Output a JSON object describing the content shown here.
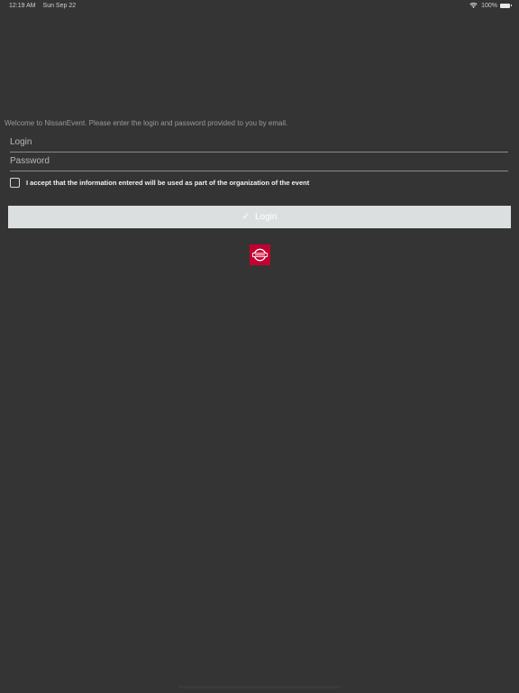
{
  "status_bar": {
    "time": "12:19 AM",
    "date": "Sun Sep 22",
    "battery": "100%"
  },
  "welcome": {
    "message": "Welcome to NissanEvent. Please enter the login and password provided to you by email."
  },
  "form": {
    "login_placeholder": "Login",
    "login_value": "",
    "password_placeholder": "Password",
    "password_value": "",
    "accept_label": "I accept that the information entered will be used as part of the organization of the event",
    "accept_checked": false,
    "submit_label": "Login",
    "submit_icon": "check-icon"
  },
  "branding": {
    "logo": "nissan-logo",
    "logo_color": "#c3002f"
  },
  "colors": {
    "background": "#343434",
    "button_background": "#dcdfe0",
    "text_primary": "#f2f2f2",
    "text_muted": "#9a9a9a"
  }
}
